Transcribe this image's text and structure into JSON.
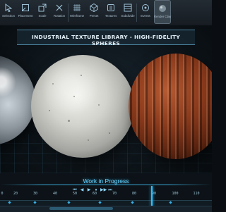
{
  "toolbar": {
    "items": [
      {
        "label": "Selection",
        "icon": "cursor-icon"
      },
      {
        "label": "Placement",
        "icon": "placement-icon"
      },
      {
        "label": "Scale",
        "icon": "scale-icon"
      },
      {
        "label": "Rotation",
        "icon": "rotation-icon"
      },
      {
        "label": "Wireframe",
        "icon": "wireframe-icon"
      },
      {
        "label": "Preset",
        "icon": "preset-icon"
      },
      {
        "label": "Textures",
        "icon": "textures-icon"
      },
      {
        "label": "Subdivide",
        "icon": "subdivide-icon"
      },
      {
        "label": "Events",
        "icon": "events-icon"
      },
      {
        "label": "Render Clay",
        "icon": "render-clay-icon"
      }
    ],
    "active_index": 9
  },
  "viewport": {
    "title": "INDUSTRIAL TEXTURE LIBRARY - HIGH-FIDELITY SPHERES"
  },
  "timeline": {
    "status": "Work in Progress",
    "ticks": [
      "0",
      "20",
      "30",
      "40",
      "50",
      "60",
      "70",
      "80",
      "90",
      "100",
      "110"
    ],
    "playhead_frame": 90,
    "controls": [
      "⏮",
      "◀",
      "▶",
      "⏸",
      "▶▶",
      "⏭"
    ]
  },
  "colors": {
    "accent": "#2fc0ff",
    "toolbar_bg": "#1c232a"
  }
}
